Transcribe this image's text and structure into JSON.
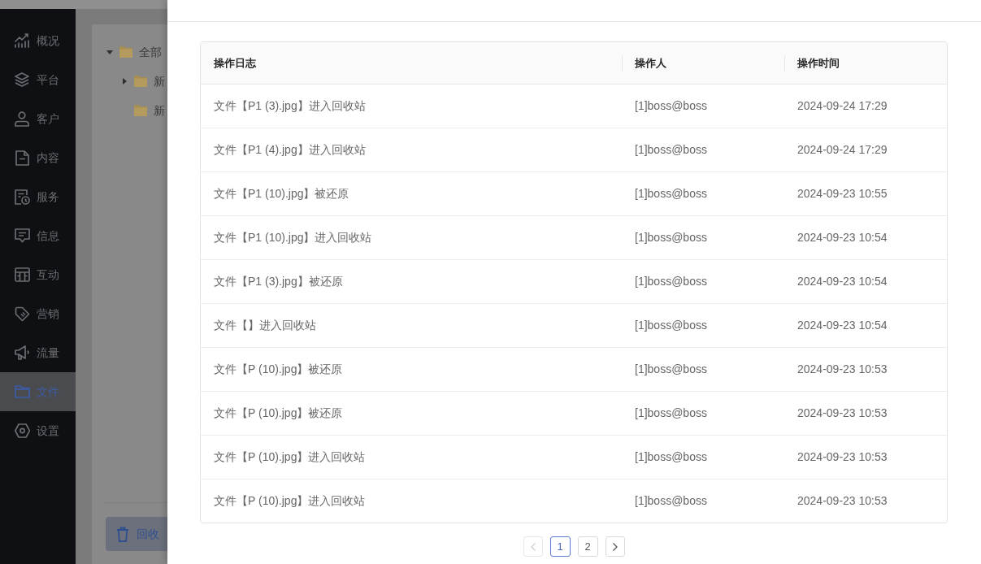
{
  "sidebar": {
    "items": [
      {
        "label": "概况",
        "selected": false
      },
      {
        "label": "平台",
        "selected": false
      },
      {
        "label": "客户",
        "selected": false
      },
      {
        "label": "内容",
        "selected": false
      },
      {
        "label": "服务",
        "selected": false
      },
      {
        "label": "信息",
        "selected": false
      },
      {
        "label": "互动",
        "selected": false
      },
      {
        "label": "营销",
        "selected": false
      },
      {
        "label": "流量",
        "selected": false
      },
      {
        "label": "文件",
        "selected": true
      },
      {
        "label": "设置",
        "selected": false
      }
    ]
  },
  "file_tree": {
    "items": [
      {
        "kind": "branch",
        "label": "全部",
        "expanded": true,
        "children": [
          {
            "kind": "branch",
            "label": "新",
            "expanded": false
          },
          {
            "kind": "leaf",
            "label": "新"
          }
        ]
      }
    ]
  },
  "recycle_button": {
    "label": "回收"
  },
  "log_table": {
    "columns": [
      "操作日志",
      "操作人",
      "操作时间"
    ],
    "rows": [
      [
        "文件【P1 (3).jpg】进入回收站",
        "[1]boss@boss",
        "2024-09-24 17:29"
      ],
      [
        "文件【P1 (4).jpg】进入回收站",
        "[1]boss@boss",
        "2024-09-24 17:29"
      ],
      [
        "文件【P1 (10).jpg】被还原",
        "[1]boss@boss",
        "2024-09-23 10:55"
      ],
      [
        "文件【P1 (10).jpg】进入回收站",
        "[1]boss@boss",
        "2024-09-23 10:54"
      ],
      [
        "文件【P1 (3).jpg】被还原",
        "[1]boss@boss",
        "2024-09-23 10:54"
      ],
      [
        "文件【】进入回收站",
        "[1]boss@boss",
        "2024-09-23 10:54"
      ],
      [
        "文件【P (10).jpg】被还原",
        "[1]boss@boss",
        "2024-09-23 10:53"
      ],
      [
        "文件【P (10).jpg】被还原",
        "[1]boss@boss",
        "2024-09-23 10:53"
      ],
      [
        "文件【P (10).jpg】进入回收站",
        "[1]boss@boss",
        "2024-09-23 10:53"
      ],
      [
        "文件【P (10).jpg】进入回收站",
        "[1]boss@boss",
        "2024-09-23 10:53"
      ]
    ]
  },
  "pagination": {
    "previous": {
      "disabled": true
    },
    "pages": [
      {
        "label": "1",
        "selected": true
      },
      {
        "label": "2",
        "selected": false
      }
    ],
    "next": {
      "disabled": false
    }
  }
}
